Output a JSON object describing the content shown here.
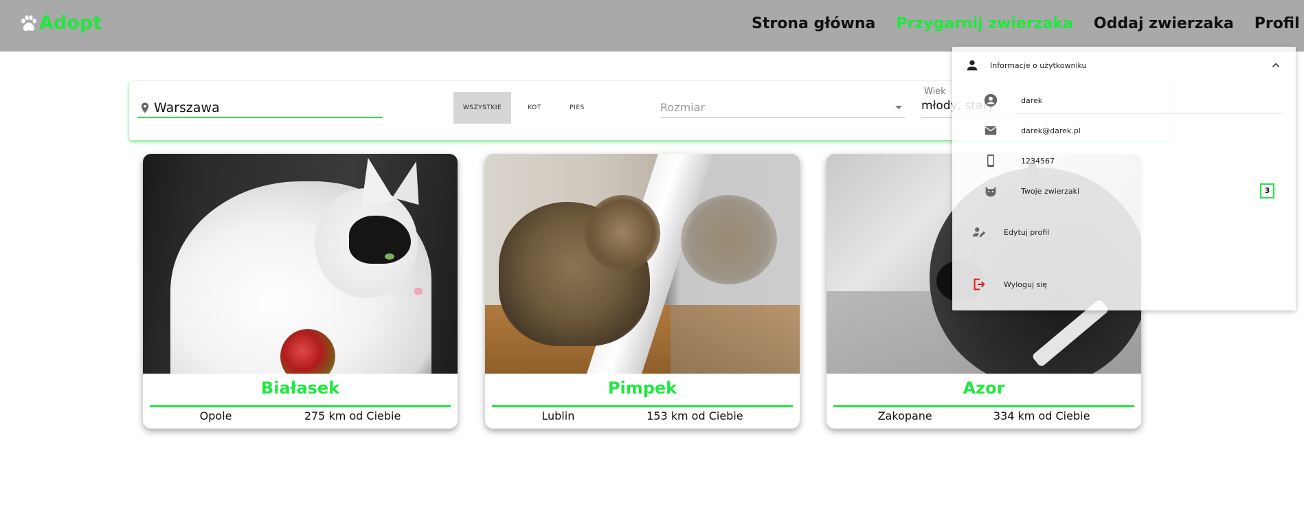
{
  "header": {
    "logo_text": "Adopt",
    "nav": [
      {
        "label": "Strona główna",
        "active": false
      },
      {
        "label": "Przygarnij zwierzaka",
        "active": true
      },
      {
        "label": "Oddaj zwierzaka",
        "active": false
      }
    ],
    "profile_label": "Profil"
  },
  "search": {
    "location_value": "Warszawa",
    "type_options": [
      "WSZYSTKIE",
      "KOT",
      "PIES"
    ],
    "type_selected": "WSZYSTKIE",
    "size_placeholder": "Rozmiar",
    "age_label": "Wiek",
    "age_value": "młody, stary"
  },
  "cards": [
    {
      "name": "Białasek",
      "city": "Opole",
      "distance": "275 km od Ciebie"
    },
    {
      "name": "Pimpek",
      "city": "Lublin",
      "distance": "153 km od Ciebie"
    },
    {
      "name": "Azor",
      "city": "Zakopane",
      "distance": "334 km od Ciebie"
    }
  ],
  "profile_menu": {
    "header_label": "Informacje o użytkowniku",
    "username": "darek",
    "email": "darek@darek.pl",
    "phone": "1234567",
    "pets_label": "Twoje zwierzaki",
    "pets_count": "3",
    "edit_label": "Edytuj profil",
    "logout_label": "Wyloguj się"
  },
  "colors": {
    "accent": "#1fe83e",
    "header_bg": "#a9a9a9",
    "logout": "#e21b1b"
  },
  "icons": {
    "logo": "paw-icon",
    "profile": "person-icon",
    "location": "location-pin-icon",
    "user": "account-circle-icon",
    "email": "mail-icon",
    "phone": "smartphone-icon",
    "pets": "cat-face-icon",
    "edit": "person-edit-icon",
    "logout": "logout-icon"
  }
}
